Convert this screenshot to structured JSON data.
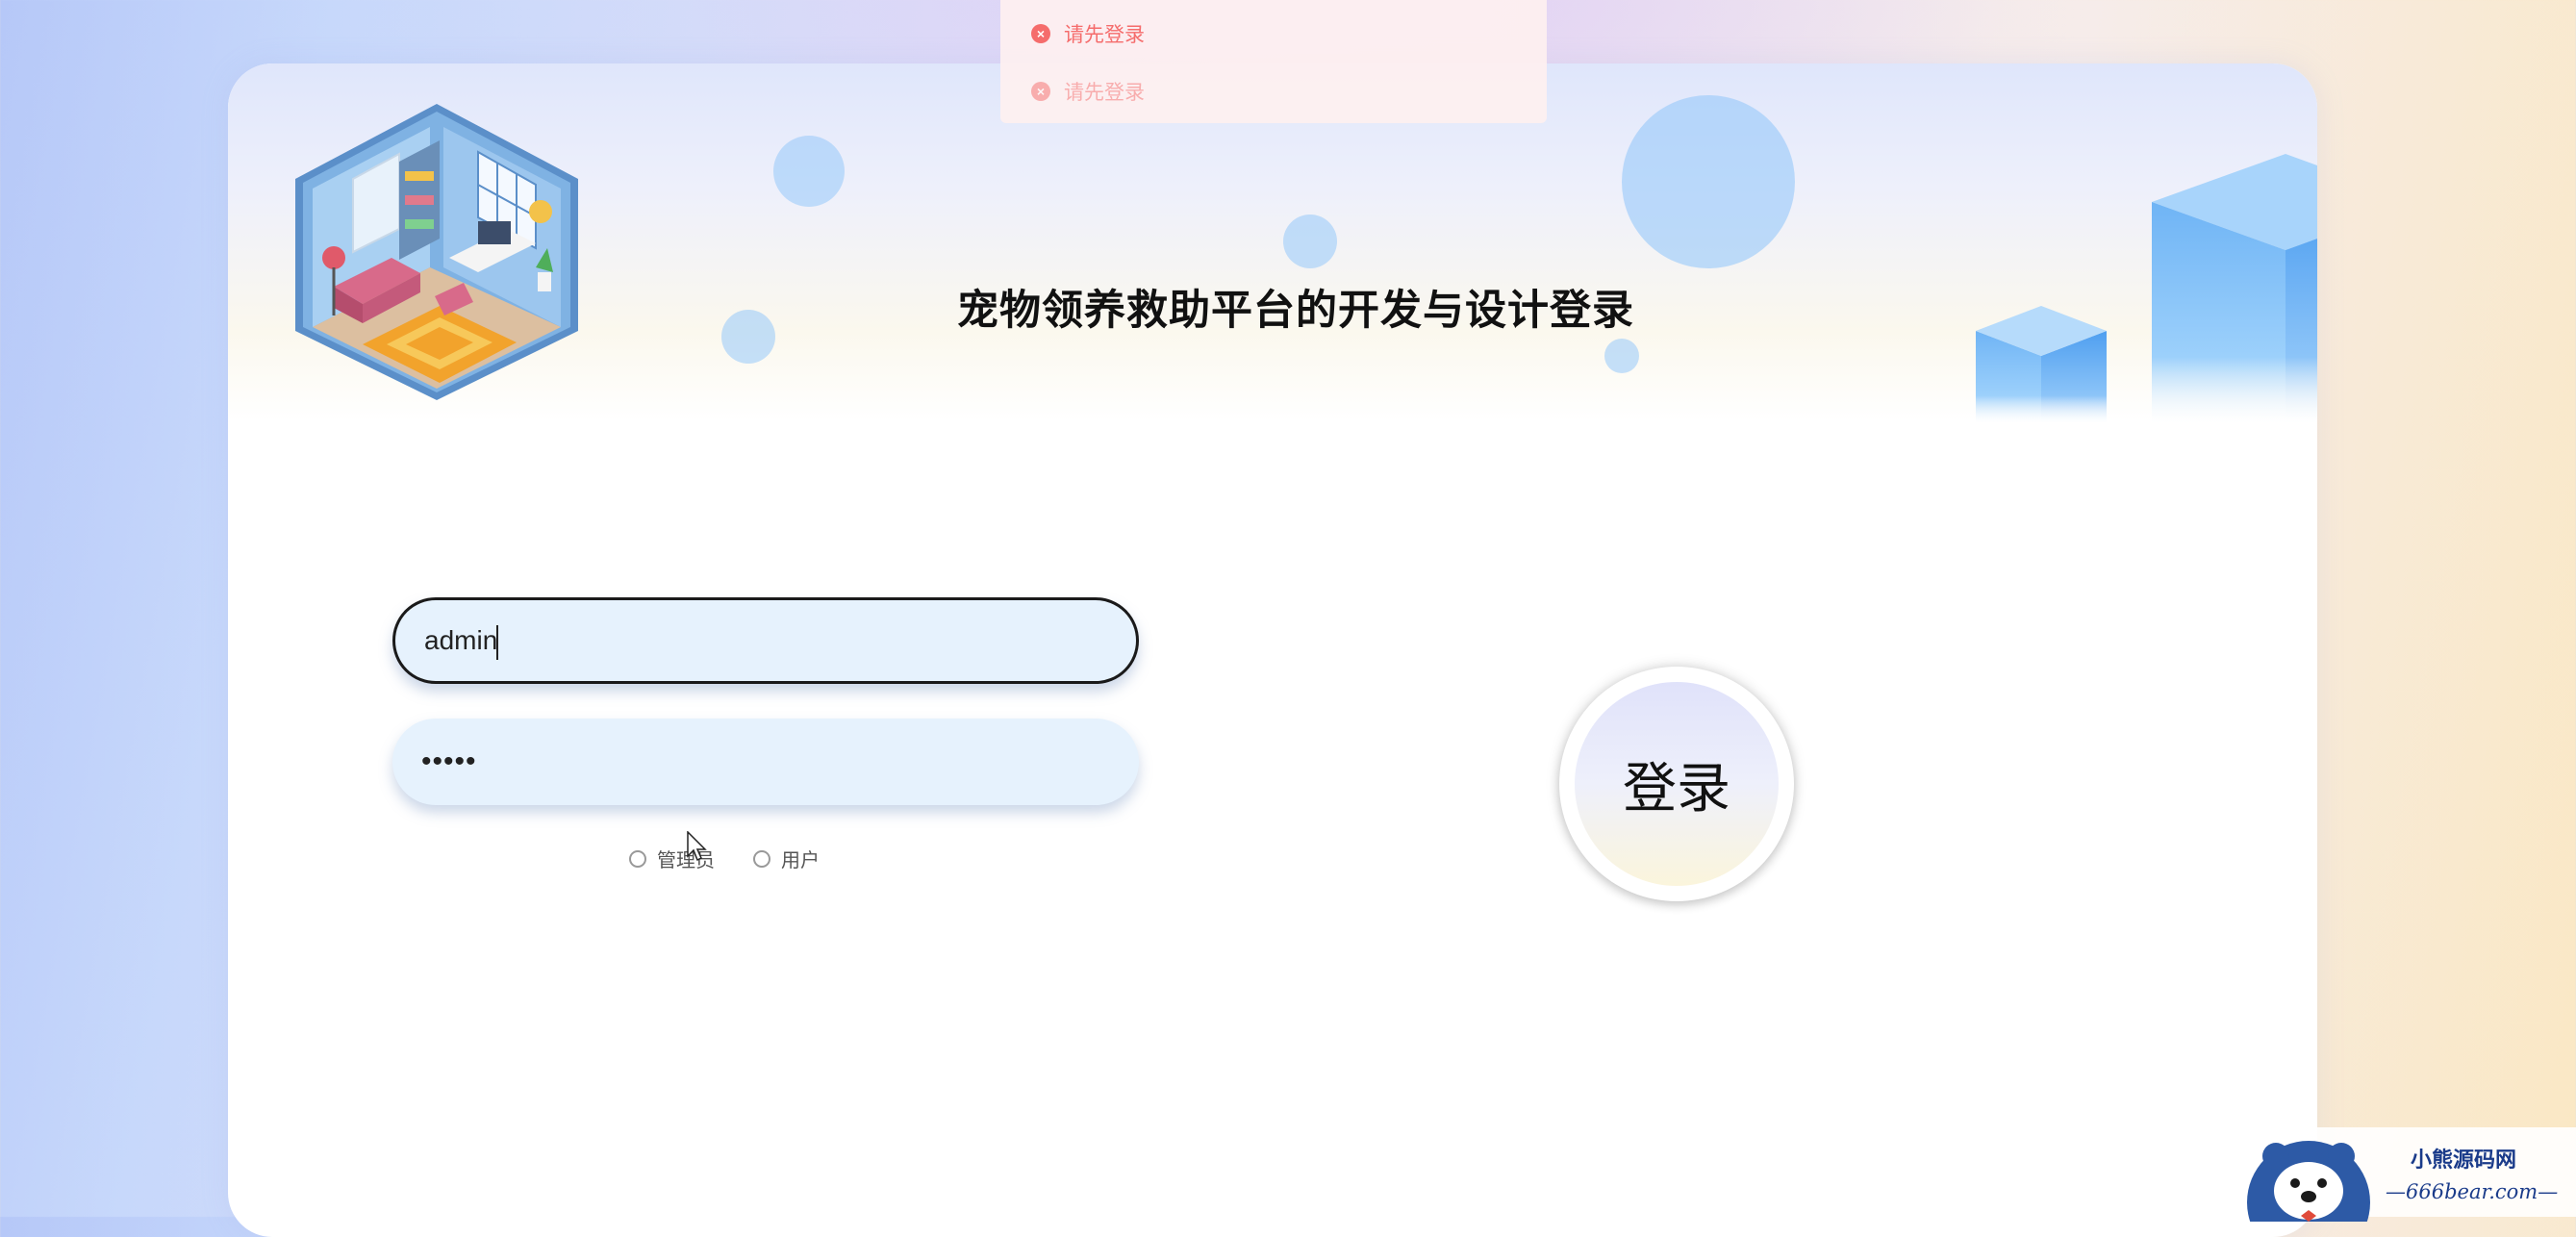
{
  "page": {
    "title": "宠物领养救助平台的开发与设计登录"
  },
  "form": {
    "username_value": "admin",
    "password_value": "12345",
    "roles": [
      {
        "label": "管理员",
        "selected": false
      },
      {
        "label": "用户",
        "selected": false
      }
    ],
    "login_label": "登录"
  },
  "toasts": [
    {
      "message": "请先登录",
      "icon": "close-circle-icon"
    },
    {
      "message": "请先登录",
      "icon": "close-circle-icon"
    }
  ],
  "watermark": {
    "line1": "小熊源码网",
    "line2": "—666bear.com—"
  },
  "colors": {
    "input_bg": "#e6f2fd",
    "error": "#f56c6c",
    "bubble": "#96c8fa"
  }
}
